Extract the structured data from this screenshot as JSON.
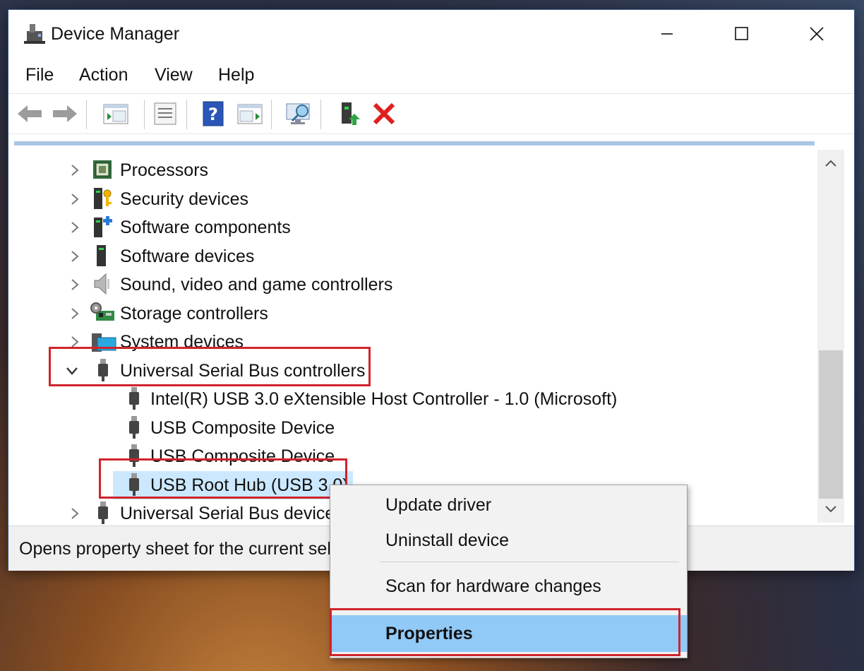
{
  "window": {
    "title": "Device Manager"
  },
  "menu": [
    "File",
    "Action",
    "View",
    "Help"
  ],
  "toolbar_icons": [
    "back-arrow-icon",
    "forward-arrow-icon",
    "show-hide-console-tree-icon",
    "properties-sheet-icon",
    "help-icon",
    "action-pane-icon",
    "scan-hardware-icon",
    "update-driver-icon",
    "uninstall-device-icon"
  ],
  "tree": {
    "items": [
      {
        "label": "Processors",
        "icon": "processor-icon",
        "level": 0,
        "expanded": false
      },
      {
        "label": "Security devices",
        "icon": "security-device-icon",
        "level": 0,
        "expanded": false
      },
      {
        "label": "Software components",
        "icon": "software-component-icon",
        "level": 0,
        "expanded": false
      },
      {
        "label": "Software devices",
        "icon": "software-device-icon",
        "level": 0,
        "expanded": false
      },
      {
        "label": "Sound, video and game controllers",
        "icon": "speaker-icon",
        "level": 0,
        "expanded": false
      },
      {
        "label": "Storage controllers",
        "icon": "storage-controller-icon",
        "level": 0,
        "expanded": false
      },
      {
        "label": "System devices",
        "icon": "system-device-icon",
        "level": 0,
        "expanded": false
      },
      {
        "label": "Universal Serial Bus controllers",
        "icon": "usb-icon",
        "level": 0,
        "expanded": true
      },
      {
        "label": "Intel(R) USB 3.0 eXtensible Host Controller - 1.0 (Microsoft)",
        "icon": "usb-icon",
        "level": 1
      },
      {
        "label": "USB Composite Device",
        "icon": "usb-icon",
        "level": 1
      },
      {
        "label": "USB Composite Device",
        "icon": "usb-icon",
        "level": 1
      },
      {
        "label": "USB Root Hub (USB 3.0)",
        "icon": "usb-icon",
        "level": 1
      },
      {
        "label": "Universal Serial Bus devices",
        "icon": "usb-icon",
        "level": 0,
        "expanded": false
      }
    ]
  },
  "status": {
    "text": "Opens property sheet for the current selection."
  },
  "context_menu": {
    "items": [
      "Update driver",
      "Uninstall device",
      "Scan for hardware changes",
      "Properties"
    ],
    "selected": "Properties"
  },
  "colors": {
    "highlight_border": "#d0242b",
    "menu_selected": "#91c9f7",
    "tree_top_bar": "#aac6e6"
  }
}
